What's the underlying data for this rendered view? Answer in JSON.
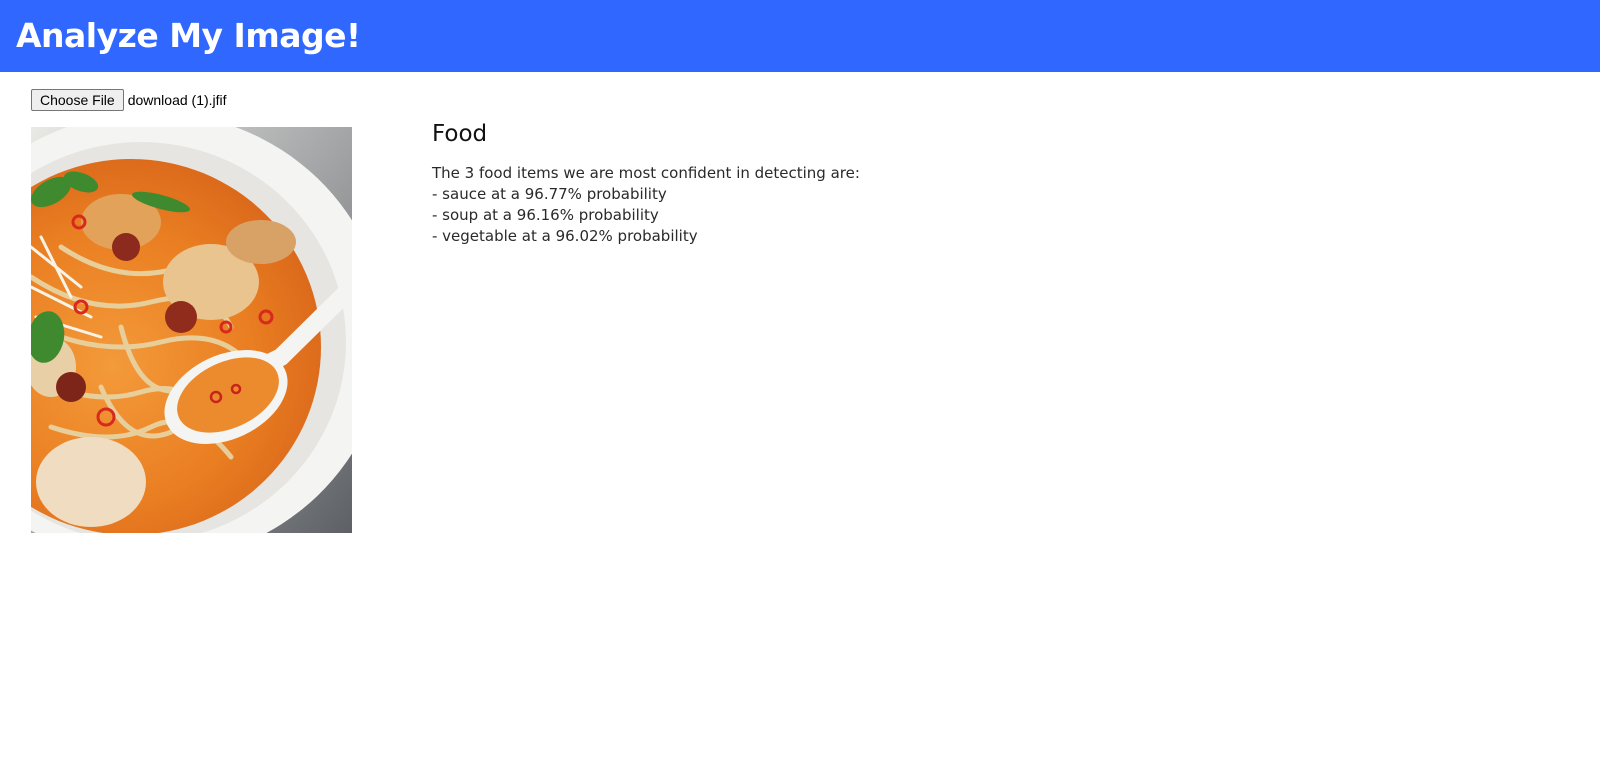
{
  "header": {
    "title": "Analyze My Image!"
  },
  "file_input": {
    "button_label": "Choose File",
    "file_name": "download (1).jfif"
  },
  "photo": {
    "icon": "food-photo-image"
  },
  "result": {
    "heading": "Food",
    "intro": "The 3 food items we are most confident in detecting are:",
    "items": [
      "- sauce at a 96.77% probability",
      "- soup at a 96.16% probability",
      "- vegetable at a 96.02% probability"
    ]
  },
  "colors": {
    "header_bg": "#3067ff",
    "header_text": "#ffffff"
  }
}
